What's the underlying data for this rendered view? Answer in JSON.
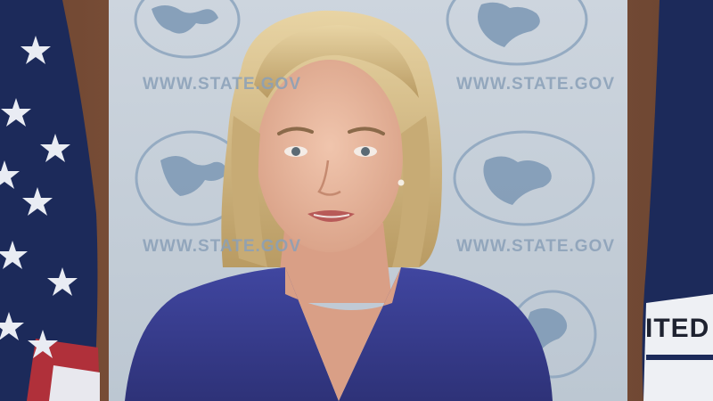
{
  "scene": {
    "backdrop_url_text": "WWW.STATE.GOV",
    "flag_lettering": "ITED",
    "colors": {
      "backdrop": "#c9d2dc",
      "map_blue": "#7f9ab6",
      "jacket": "#3a3f8f",
      "hair": "#d6bf8a",
      "skin": "#e8b9a0",
      "wood": "#7a5238",
      "flag_blue": "#1c2a5a"
    }
  }
}
